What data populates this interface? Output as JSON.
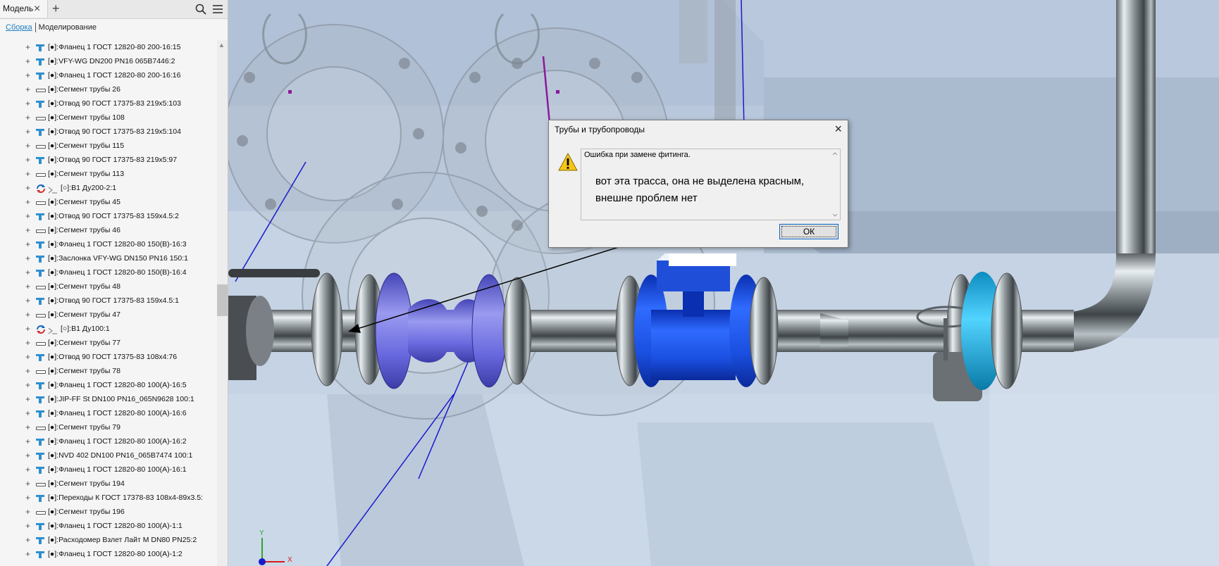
{
  "browser": {
    "tab_label": "Модель",
    "tab_close": "×",
    "tab_add": "+",
    "subtabs": {
      "assembly": "Сборка",
      "modeling": "Моделирование"
    },
    "items": [
      {
        "label": "[●]:Фланец 1 ГОСТ 12820-80 200-16:15",
        "icon": "flange-icon"
      },
      {
        "label": "[●]:VFY-WG DN200 PN16 065B7446:2",
        "icon": "valve-icon"
      },
      {
        "label": "[●]:Фланец 1 ГОСТ 12820-80 200-16:16",
        "icon": "flange-icon"
      },
      {
        "label": "[●]:Сегмент трубы 26",
        "icon": "pipe-segment-icon"
      },
      {
        "label": "[●]:Отвод 90 ГОСТ 17375-83 219x5:103",
        "icon": "elbow-icon"
      },
      {
        "label": "[●]:Сегмент трубы 108",
        "icon": "pipe-segment-icon"
      },
      {
        "label": "[●]:Отвод 90 ГОСТ 17375-83 219x5:104",
        "icon": "elbow-icon"
      },
      {
        "label": "[●]:Сегмент трубы 115",
        "icon": "pipe-segment-icon"
      },
      {
        "label": "[●]:Отвод 90 ГОСТ 17375-83 219x5:97",
        "icon": "elbow-icon"
      },
      {
        "label": "[●]:Сегмент трубы 113",
        "icon": "pipe-segment-icon"
      },
      {
        "label": "[○]:В1 Ду200-2:1",
        "icon": "route-update-icon"
      },
      {
        "label": "[●]:Сегмент трубы 45",
        "icon": "pipe-segment-icon"
      },
      {
        "label": "[●]:Отвод 90 ГОСТ 17375-83 159x4.5:2",
        "icon": "elbow-icon"
      },
      {
        "label": "[●]:Сегмент трубы 46",
        "icon": "pipe-segment-icon"
      },
      {
        "label": "[●]:Фланец 1 ГОСТ 12820-80 150(B)-16:3",
        "icon": "flange-icon"
      },
      {
        "label": "[●]:Заслонка VFY-WG DN150 PN16 150:1",
        "icon": "valve-icon"
      },
      {
        "label": "[●]:Фланец 1 ГОСТ 12820-80 150(B)-16:4",
        "icon": "flange-icon"
      },
      {
        "label": "[●]:Сегмент трубы 48",
        "icon": "pipe-segment-icon"
      },
      {
        "label": "[●]:Отвод 90 ГОСТ 17375-83 159x4.5:1",
        "icon": "elbow-icon"
      },
      {
        "label": "[●]:Сегмент трубы 47",
        "icon": "pipe-segment-icon"
      },
      {
        "label": "[○]:В1 Ду100:1",
        "icon": "route-update-icon"
      },
      {
        "label": "[●]:Сегмент трубы 77",
        "icon": "pipe-segment-icon"
      },
      {
        "label": "[●]:Отвод 90 ГОСТ 17375-83 108x4:76",
        "icon": "elbow-icon"
      },
      {
        "label": "[●]:Сегмент трубы 78",
        "icon": "pipe-segment-icon"
      },
      {
        "label": "[●]:Фланец 1 ГОСТ 12820-80 100(A)-16:5",
        "icon": "flange-icon"
      },
      {
        "label": "[●]:JIP-FF St DN100 PN16_065N9628 100:1",
        "icon": "valve-icon"
      },
      {
        "label": "[●]:Фланец 1 ГОСТ 12820-80 100(A)-16:6",
        "icon": "flange-icon"
      },
      {
        "label": "[●]:Сегмент трубы 79",
        "icon": "pipe-segment-icon"
      },
      {
        "label": "[●]:Фланец 1 ГОСТ 12820-80 100(A)-16:2",
        "icon": "flange-icon"
      },
      {
        "label": "[●]:NVD 402 DN100 PN16_065B7474 100:1",
        "icon": "valve-icon"
      },
      {
        "label": "[●]:Фланец 1 ГОСТ 12820-80 100(A)-16:1",
        "icon": "flange-icon"
      },
      {
        "label": "[●]:Сегмент трубы 194",
        "icon": "pipe-segment-icon"
      },
      {
        "label": "[●]:Переходы К ГОСТ 17378-83 108x4-89x3.5:",
        "icon": "reducer-icon"
      },
      {
        "label": "[●]:Сегмент трубы 196",
        "icon": "pipe-segment-icon"
      },
      {
        "label": "[●]:Фланец 1 ГОСТ 12820-80 100(A)-1:1",
        "icon": "flange-icon"
      },
      {
        "label": "[●]:Расходомер Взлет Лайт М DN80 PN25:2",
        "icon": "flowmeter-icon"
      },
      {
        "label": "[●]:Фланец 1 ГОСТ 12820-80 100(A)-1:2",
        "icon": "flange-icon"
      }
    ]
  },
  "dialog": {
    "title": "Трубы и трубопроводы",
    "close": "×",
    "message": "Ошибка при замене фитинга.",
    "ok_label": "ОК"
  },
  "annotation": {
    "line1": "вот эта трасса, она не выделена красным,",
    "line2": "внешне проблем нет"
  },
  "viewcube": {
    "x_label": "X",
    "y_label": "Y"
  },
  "colors": {
    "flowmeter_blue": "#1a4fe0",
    "valve_purple": "#6a6ae0",
    "gate_valve_cyan": "#2ab8e8",
    "pipe_steel": "#9aa3a8",
    "highlight_route": "#1a1acc"
  }
}
